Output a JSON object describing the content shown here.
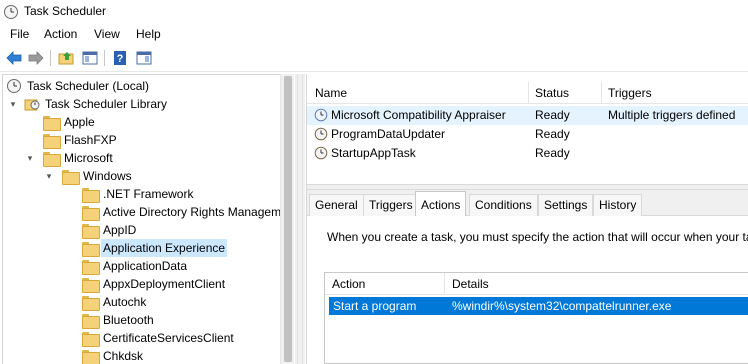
{
  "window": {
    "title": "Task Scheduler",
    "icon": "clock-icon"
  },
  "menu": [
    "File",
    "Action",
    "View",
    "Help"
  ],
  "toolbar": {
    "buttons": [
      "back-arrow-icon",
      "forward-arrow-icon",
      "up-folder-icon",
      "show-hide-console-tree-icon",
      "help-icon",
      "show-hide-action-pane-icon"
    ]
  },
  "tree": {
    "items": [
      {
        "label": "Task Scheduler (Local)",
        "icon": "clock-icon",
        "expander": ""
      },
      {
        "label": "Task Scheduler Library",
        "icon": "library-clock-icon",
        "expander": "▾"
      },
      {
        "label": "Apple",
        "icon": "folder-icon",
        "expander": ""
      },
      {
        "label": "FlashFXP",
        "icon": "folder-icon",
        "expander": ""
      },
      {
        "label": "Microsoft",
        "icon": "folder-icon",
        "expander": "▾"
      },
      {
        "label": "Windows",
        "icon": "folder-icon",
        "expander": "▾"
      },
      {
        "label": ".NET Framework",
        "icon": "folder-icon",
        "expander": ""
      },
      {
        "label": "Active Directory Rights Managem",
        "icon": "folder-icon",
        "expander": ""
      },
      {
        "label": "AppID",
        "icon": "folder-icon",
        "expander": ""
      },
      {
        "label": "Application Experience",
        "icon": "folder-icon",
        "expander": "",
        "selected": true
      },
      {
        "label": "ApplicationData",
        "icon": "folder-icon",
        "expander": ""
      },
      {
        "label": "AppxDeploymentClient",
        "icon": "folder-icon",
        "expander": ""
      },
      {
        "label": "Autochk",
        "icon": "folder-icon",
        "expander": ""
      },
      {
        "label": "Bluetooth",
        "icon": "folder-icon",
        "expander": ""
      },
      {
        "label": "CertificateServicesClient",
        "icon": "folder-icon",
        "expander": ""
      },
      {
        "label": "Chkdsk",
        "icon": "folder-icon",
        "expander": ""
      }
    ]
  },
  "task_list": {
    "columns": [
      "Name",
      "Status",
      "Triggers"
    ],
    "rows": [
      {
        "name": "Microsoft Compatibility Appraiser",
        "status": "Ready",
        "triggers": "Multiple triggers defined",
        "selected": true
      },
      {
        "name": "ProgramDataUpdater",
        "status": "Ready",
        "triggers": ""
      },
      {
        "name": "StartupAppTask",
        "status": "Ready",
        "triggers": ""
      }
    ]
  },
  "tabs": [
    "General",
    "Triggers",
    "Actions",
    "Conditions",
    "Settings",
    "History"
  ],
  "active_tab": "Actions",
  "actions_panel": {
    "description": "When you create a task, you must specify the action that will occur when your ta",
    "columns": [
      "Action",
      "Details"
    ],
    "rows": [
      {
        "action": "Start a program",
        "details": "%windir%\\system32\\compattelrunner.exe"
      }
    ]
  },
  "colors": {
    "selection_blue": "#0078d7",
    "tree_selection": "#cce8ff",
    "row_hover": "#e5f3ff",
    "folder": "#f5d27a"
  }
}
